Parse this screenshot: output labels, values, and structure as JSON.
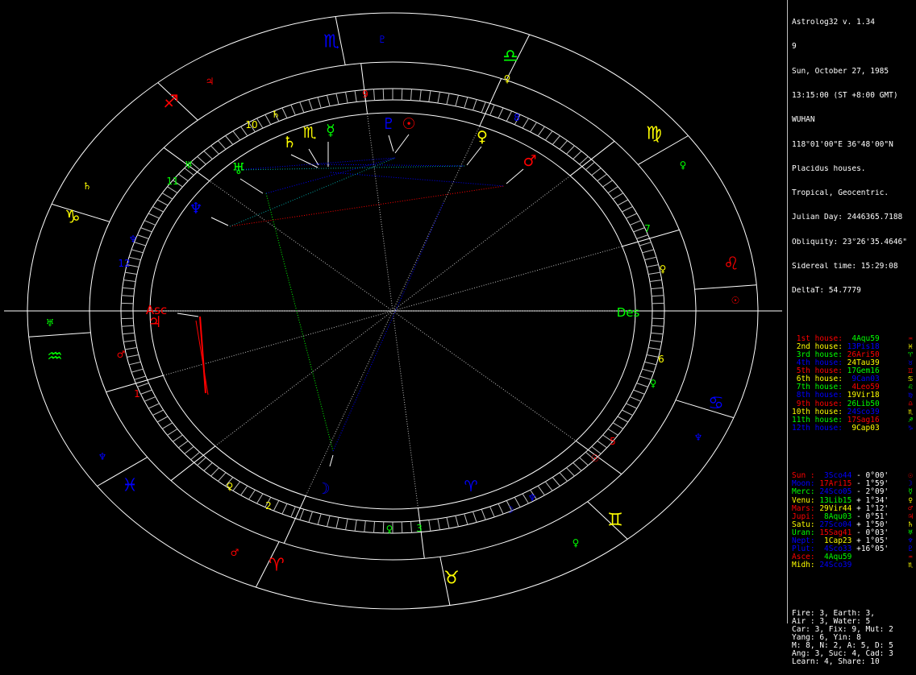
{
  "header": {
    "title": "Astrolog32 v. 1.34",
    "chart_number": "9",
    "date": "Sun, October 27, 1985",
    "time": "13:15:00 (ST +8:00 GMT)",
    "location": "WUHAN",
    "coordinates": "118°01'00\"E 36°48'00\"N",
    "house_system": "Placidus houses.",
    "zodiac": "Tropical, Geocentric.",
    "julian_day": "Julian Day: 2446365.7188",
    "obliquity": "Obliquity: 23°26'35.4646\"",
    "sidereal_time": "Sidereal time: 15:29:08",
    "delta_t": "DeltaT: 54.7779"
  },
  "houses": [
    {
      "label": "1st house:",
      "value": "4Aqu59",
      "glyph": "♒",
      "label_color": "#ff0000",
      "value_color": "#00ff00"
    },
    {
      "label": "2nd house:",
      "value": "13Pis18",
      "glyph": "♓",
      "label_color": "#ffff00",
      "value_color": "#0000ff"
    },
    {
      "label": "3rd house:",
      "value": "26Ari50",
      "glyph": "♈",
      "label_color": "#00ff00",
      "value_color": "#ff0000"
    },
    {
      "label": "4th house:",
      "value": "24Tau39",
      "glyph": "♉",
      "label_color": "#0000ff",
      "value_color": "#ffff00"
    },
    {
      "label": "5th house:",
      "value": "17Gem16",
      "glyph": "♊",
      "label_color": "#ff0000",
      "value_color": "#00ff00"
    },
    {
      "label": "6th house:",
      "value": "9Can03",
      "glyph": "♋",
      "label_color": "#ffff00",
      "value_color": "#0000ff"
    },
    {
      "label": "7th house:",
      "value": "4Leo59",
      "glyph": "♌",
      "label_color": "#00ff00",
      "value_color": "#ff0000"
    },
    {
      "label": "8th house:",
      "value": "19Vir18",
      "glyph": "♍",
      "label_color": "#0000ff",
      "value_color": "#ffff00"
    },
    {
      "label": "9th house:",
      "value": "26Lib50",
      "glyph": "♎",
      "label_color": "#ff0000",
      "value_color": "#00ff00"
    },
    {
      "label": "10th house:",
      "value": "24Sco39",
      "glyph": "♏",
      "label_color": "#ffff00",
      "value_color": "#0000ff"
    },
    {
      "label": "11th house:",
      "value": "17Sag16",
      "glyph": "♐",
      "label_color": "#00ff00",
      "value_color": "#ff0000"
    },
    {
      "label": "12th house:",
      "value": "9Cap03",
      "glyph": "♑",
      "label_color": "#0000ff",
      "value_color": "#ffff00"
    }
  ],
  "planets": [
    {
      "name": "Sun :",
      "position": "3Sco44",
      "motion": "- 0°00'",
      "glyph": "☉",
      "name_color": "#ff0000",
      "position_color": "#0000ff"
    },
    {
      "name": "Moon:",
      "position": "17Ari15",
      "motion": "- 1°59'",
      "glyph": "☽",
      "name_color": "#0000ff",
      "position_color": "#ff0000"
    },
    {
      "name": "Merc:",
      "position": "24Sco05",
      "motion": "- 2°09'",
      "glyph": "☿",
      "name_color": "#00ff00",
      "position_color": "#0000ff"
    },
    {
      "name": "Venu:",
      "position": "13Lib15",
      "motion": "+ 1°34'",
      "glyph": "♀",
      "name_color": "#ffff00",
      "position_color": "#00ff00"
    },
    {
      "name": "Mars:",
      "position": "29Vir44",
      "motion": "+ 1°12'",
      "glyph": "♂",
      "name_color": "#ff0000",
      "position_color": "#ffff00"
    },
    {
      "name": "Jupi:",
      "position": "8Aqu03",
      "motion": "- 0°51'",
      "glyph": "♃",
      "name_color": "#ff0000",
      "position_color": "#00ff00"
    },
    {
      "name": "Satu:",
      "position": "27Sco04",
      "motion": "+ 1°50'",
      "glyph": "♄",
      "name_color": "#ffff00",
      "position_color": "#0000ff"
    },
    {
      "name": "Uran:",
      "position": "15Sag41",
      "motion": "- 0°03'",
      "glyph": "♅",
      "name_color": "#00ff00",
      "position_color": "#ff0000"
    },
    {
      "name": "Nept:",
      "position": "1Cap23",
      "motion": "+ 1°05'",
      "glyph": "♆",
      "name_color": "#0000ff",
      "position_color": "#ffff00"
    },
    {
      "name": "Plut:",
      "position": "4Sco33",
      "motion": "+16°05'",
      "glyph": "♇",
      "name_color": "#0000ff",
      "position_color": "#0000ff"
    },
    {
      "name": "Asce:",
      "position": "4Aqu59",
      "motion": "",
      "glyph": "♒",
      "name_color": "#ff0000",
      "position_color": "#00ff00"
    },
    {
      "name": "Midh:",
      "position": "24Sco39",
      "motion": "",
      "glyph": "♏",
      "name_color": "#ffff00",
      "position_color": "#0000ff"
    }
  ],
  "stats": [
    "Fire: 3, Earth: 3,",
    "Air : 3, Water: 5",
    "Car: 3, Fix: 9, Mut: 2",
    "Yang: 6, Yin: 8",
    "M: 8, N: 2, A: 5, D: 5",
    "Ang: 3, Suc: 4, Cad: 3",
    "Learn: 4, Share: 10"
  ],
  "wheel": {
    "ascendant_label": "Asc",
    "descendant_label": "Des",
    "house_numbers": [
      "1",
      "2",
      "3",
      "4",
      "5",
      "6",
      "7",
      "8",
      "9",
      "10",
      "11",
      "12"
    ],
    "colors": {
      "red": "#ff0000",
      "yellow": "#ffff00",
      "green": "#00ff00",
      "blue": "#0000ff",
      "white": "#ffffff",
      "gray": "#c0c0c0"
    }
  }
}
